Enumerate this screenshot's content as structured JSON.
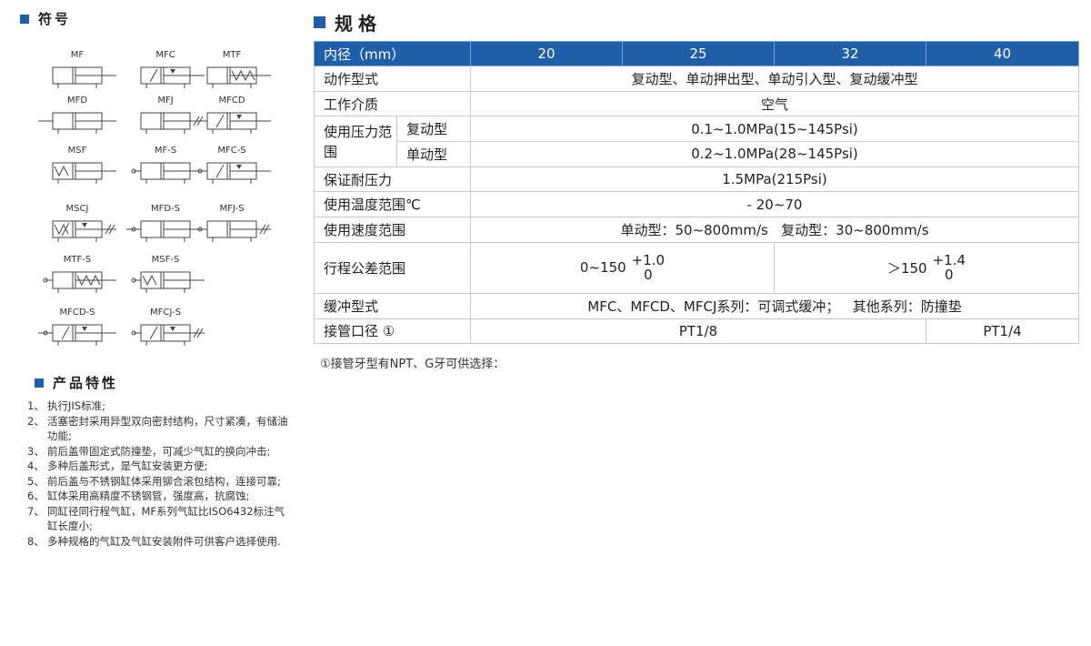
{
  "symbols": {
    "title": "符号",
    "items": [
      {
        "label": "MF"
      },
      {
        "label": "MFC"
      },
      {
        "label": "MTF"
      },
      {
        "label": "MFD"
      },
      {
        "label": "MFJ"
      },
      {
        "label": "MFCD"
      },
      {
        "label": "MSF"
      },
      {
        "label": "MF-S"
      },
      {
        "label": "MFC-S"
      },
      {
        "label": "MSCJ"
      },
      {
        "label": "MFD-S"
      },
      {
        "label": "MFJ-S"
      },
      {
        "label": "MTF-S"
      },
      {
        "label": "MSF-S"
      },
      {
        "label": "MFCD-S"
      },
      {
        "label": "MFCJ-S"
      }
    ]
  },
  "features": {
    "title": "产品特性",
    "items": [
      {
        "num": "1、",
        "text": "执行JIS标准;"
      },
      {
        "num": "2、",
        "text": "活塞密封采用异型双向密封结构，尺寸紧凑，有储油功能;"
      },
      {
        "num": "3、",
        "text": "前后盖带固定式防撞垫，可减少气缸的换向冲击;"
      },
      {
        "num": "4、",
        "text": "多种后盖形式，是气缸安装更方便;"
      },
      {
        "num": "5、",
        "text": "前后盖与不锈钢缸体采用铆合滚包结构，连接可靠;"
      },
      {
        "num": "6、",
        "text": "缸体采用高精度不锈钢管，强度高，抗腐蚀;"
      },
      {
        "num": "7、",
        "text": "同缸径同行程气缸，MF系列气缸比ISO6432标注气缸长度小;"
      },
      {
        "num": "8、",
        "text": "多种规格的气缸及气缸安装附件可供客户选择使用."
      }
    ]
  },
  "spec": {
    "title": "规格",
    "header": {
      "label": "内径（mm）",
      "bores": [
        "20",
        "25",
        "32",
        "40"
      ]
    },
    "rows": {
      "action_label": "动作型式",
      "action_value": "复动型、单动押出型、单动引入型、复动缓冲型",
      "medium_label": "工作介质",
      "medium_value": "空气",
      "pressure_label": "使用压力范围",
      "pressure_double_label": "复动型",
      "pressure_double_value": "0.1~1.0MPa(15~145Psi)",
      "pressure_single_label": "单动型",
      "pressure_single_value": "0.2~1.0MPa(28~145Psi)",
      "proof_label": "保证耐压力",
      "proof_value": "1.5MPa(215Psi)",
      "temp_label": "使用温度范围℃",
      "temp_value": "- 20~70",
      "speed_label": "使用速度范围",
      "speed_value": "单动型：50~800mm/s   复动型：30~800mm/s",
      "stroke_label": "行程公差范围",
      "stroke_a_range": "0~150",
      "stroke_a_upper": "+1.0",
      "stroke_a_lower": "0",
      "stroke_b_range": "＞150",
      "stroke_b_upper": "+1.4",
      "stroke_b_lower": "0",
      "cushion_label": "缓冲型式",
      "cushion_value": "MFC、MFCD、MFCJ系列：可调式缓冲；   其他系列：防撞垫",
      "port_label": "接管口径 ①",
      "port_small": "PT1/8",
      "port_large": "PT1/4"
    },
    "note": "①接管牙型有NPT、G牙可供选择："
  },
  "colors": {
    "accent": "#1f5ea8",
    "border": "#c9c9c9"
  }
}
